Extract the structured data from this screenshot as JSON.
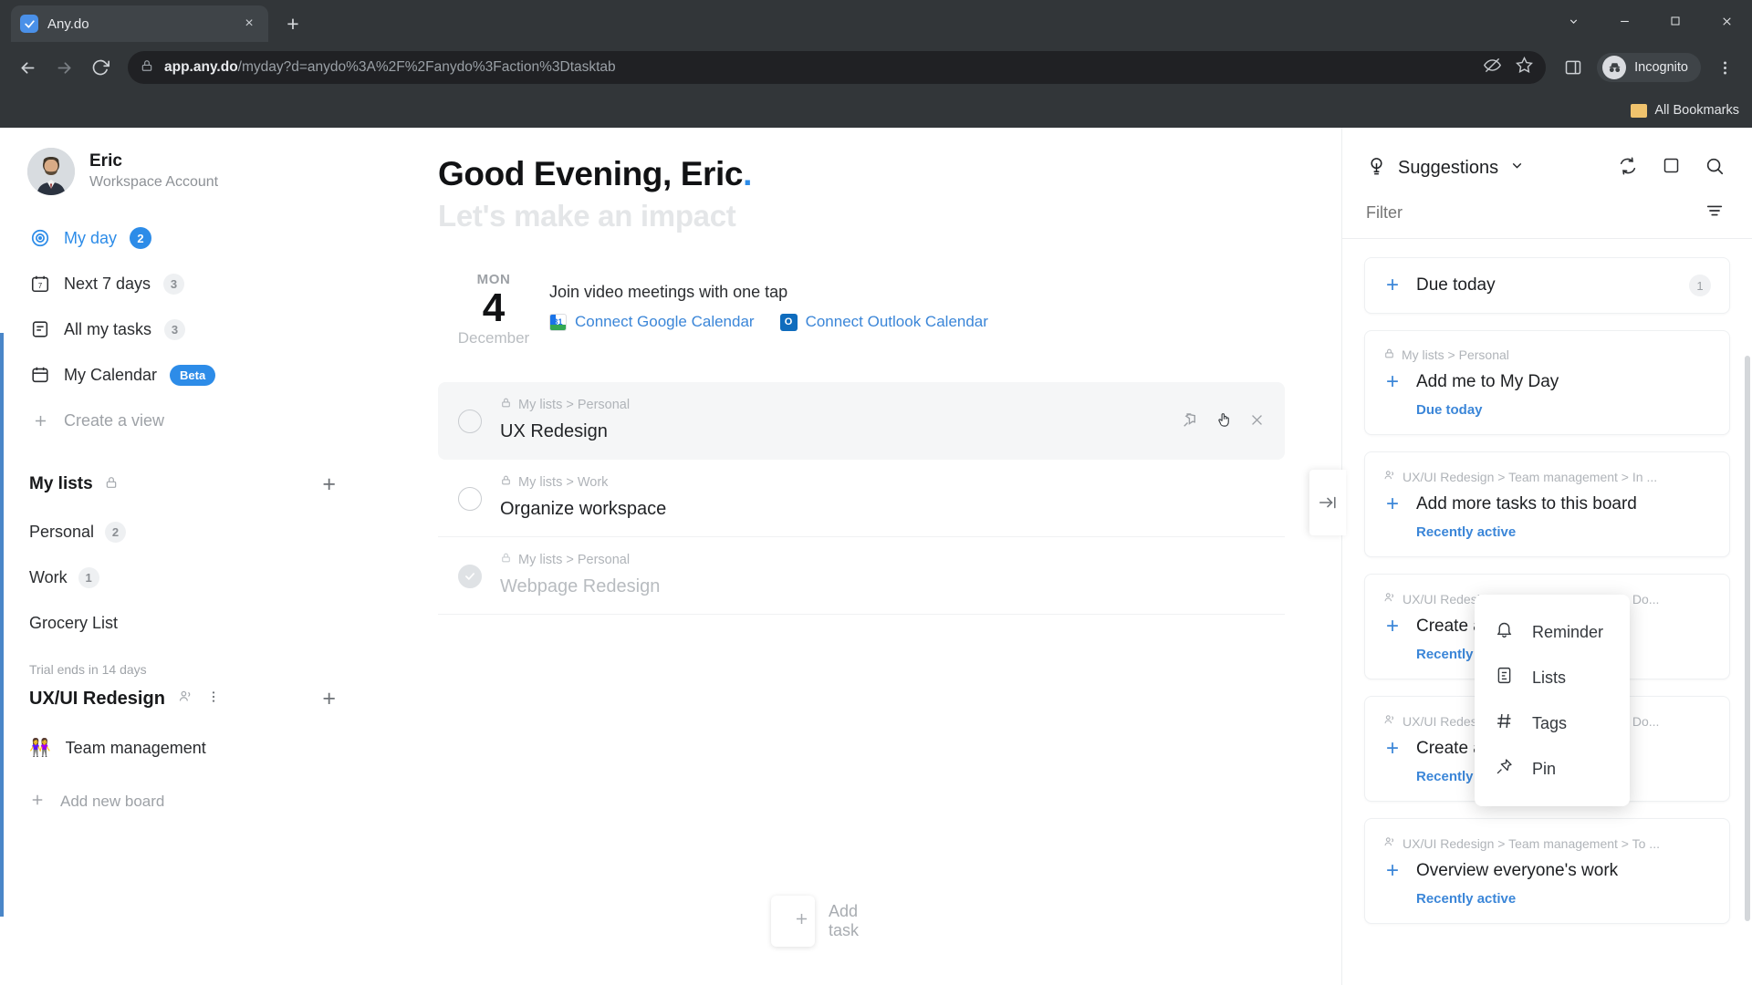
{
  "browser": {
    "tab": {
      "title": "Any.do",
      "favicon": "check-icon",
      "close": "×"
    },
    "new_tab_label": "+",
    "url_bold": "app.any.do",
    "url_rest": "/myday?d=anydo%3A%2F%2Fanydo%3Faction%3Dtasktab",
    "profile_label": "Incognito",
    "bookmarks_label": "All Bookmarks",
    "window_minimize": "—",
    "window_maximize": "▢",
    "window_close": "✕"
  },
  "sidebar": {
    "profile": {
      "name": "Eric",
      "subtitle": "Workspace Account"
    },
    "nav": [
      {
        "label": "My day",
        "badge": "2",
        "badge_type": "blue",
        "icon": "target-icon",
        "active": true
      },
      {
        "label": "Next 7 days",
        "badge": "3",
        "badge_type": "grey",
        "icon": "calendar-7-icon",
        "active": false
      },
      {
        "label": "All my tasks",
        "badge": "3",
        "badge_type": "grey",
        "icon": "list-icon",
        "active": false
      },
      {
        "label": "My Calendar",
        "badge": "Beta",
        "badge_type": "beta",
        "icon": "calendar-icon",
        "active": false
      }
    ],
    "create_view_label": "Create a view",
    "my_lists_title": "My lists",
    "lists": [
      {
        "label": "Personal",
        "count": "2"
      },
      {
        "label": "Work",
        "count": "1"
      },
      {
        "label": "Grocery List",
        "count": ""
      }
    ],
    "trial_text": "Trial ends in 14 days",
    "board_group_title": "UX/UI Redesign",
    "boards": [
      {
        "emoji": "👭",
        "label": "Team management"
      }
    ],
    "add_board_label": "Add new board"
  },
  "main": {
    "greeting": "Good Evening, Eric",
    "subgreeting": "Let's make an impact",
    "date": {
      "dow": "MON",
      "day": "4",
      "month": "December"
    },
    "meeting_title": "Join video meetings with one tap",
    "connect_google": "Connect Google Calendar",
    "connect_outlook": "Connect Outlook Calendar",
    "tasks": [
      {
        "crumb": "My lists > Personal",
        "title": "UX Redesign",
        "done": false,
        "hovered": true
      },
      {
        "crumb": "My lists > Work",
        "title": "Organize workspace",
        "done": false,
        "hovered": false
      },
      {
        "crumb": "My lists > Personal",
        "title": "Webpage Redesign",
        "done": true,
        "hovered": false
      }
    ],
    "add_task_placeholder": "Add task"
  },
  "context_menu": [
    {
      "label": "Reminder",
      "icon": "bell-icon"
    },
    {
      "label": "Lists",
      "icon": "list-doc-icon"
    },
    {
      "label": "Tags",
      "icon": "hash-icon"
    },
    {
      "label": "Pin",
      "icon": "pin-icon"
    }
  ],
  "right_panel": {
    "title": "Suggestions",
    "filter_placeholder": "Filter",
    "due_today": {
      "label": "Due today",
      "count": "1"
    },
    "suggestions": [
      {
        "crumb": "My lists > Personal",
        "crumb_icon": "lock-icon",
        "title": "Add me to My Day",
        "meta": "Due today"
      },
      {
        "crumb": "UX/UI Redesign > Team management > In ...",
        "crumb_icon": "people-icon",
        "title": "Add more tasks to this board",
        "meta": "Recently active"
      },
      {
        "crumb": "UX/UI Redesign > Team management > Do...",
        "crumb_icon": "people-icon",
        "title": "Create a board",
        "meta": "Recently active"
      },
      {
        "crumb": "UX/UI Redesign > Team management > Do...",
        "crumb_icon": "people-icon",
        "title": "Create a workspace",
        "meta": "Recently active"
      },
      {
        "crumb": "UX/UI Redesign > Team management > To ...",
        "crumb_icon": "people-icon",
        "title": "Overview everyone's work",
        "meta": "Recently active"
      }
    ],
    "collapse_label": "→|"
  },
  "colors": {
    "accent": "#2d8ce8",
    "link": "#3b86d8",
    "chrome": "#323639"
  }
}
